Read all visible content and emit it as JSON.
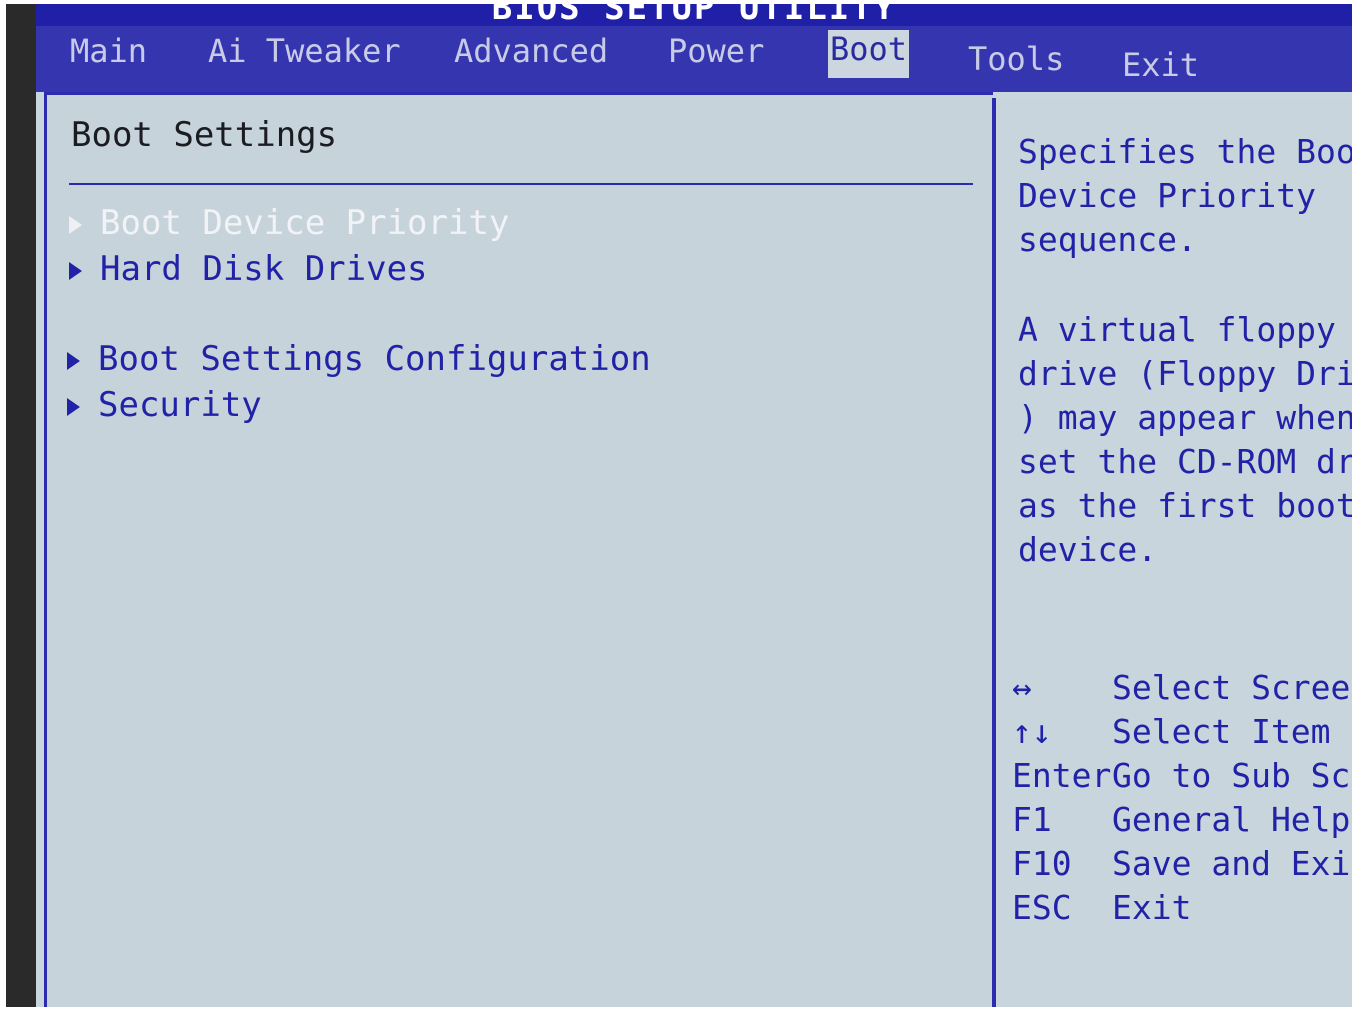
{
  "app": {
    "title": "BIOS SETUP UTILITY"
  },
  "menu_bar": {
    "tabs": [
      {
        "label": "Main"
      },
      {
        "label": "Ai Tweaker"
      },
      {
        "label": "Advanced"
      },
      {
        "label": "Power"
      },
      {
        "label": "Boot",
        "active": true
      },
      {
        "label": "Tools"
      },
      {
        "label": "Exit"
      }
    ]
  },
  "main": {
    "section_title": "Boot Settings",
    "items": [
      {
        "label": "Boot Device Priority",
        "selected": true
      },
      {
        "label": "Hard Disk Drives"
      },
      {
        "label": "Boot Settings Configuration"
      },
      {
        "label": "Security"
      }
    ]
  },
  "help": {
    "description": "Specifies the Boot\nDevice Priority\nsequence.",
    "note": "A virtual floppy dis\ndrive (Floppy Drive\n) may appear when yo\nset the CD-ROM drive\nas the first boot\ndevice.",
    "keys": [
      {
        "key": "↔",
        "action": "Select Screen"
      },
      {
        "key": "↑↓",
        "action": "Select Item"
      },
      {
        "key": "Enter",
        "action": "Go to Sub Scree"
      },
      {
        "key": "F1",
        "action": "General Help"
      },
      {
        "key": "F10",
        "action": "Save and Exit"
      },
      {
        "key": "ESC",
        "action": "Exit"
      }
    ]
  },
  "colors": {
    "menu_bar_bg": "#3535b0",
    "panel_bg": "#c7d3da",
    "accent_text": "#2222a8",
    "selected_text": "#f1f3f6"
  }
}
